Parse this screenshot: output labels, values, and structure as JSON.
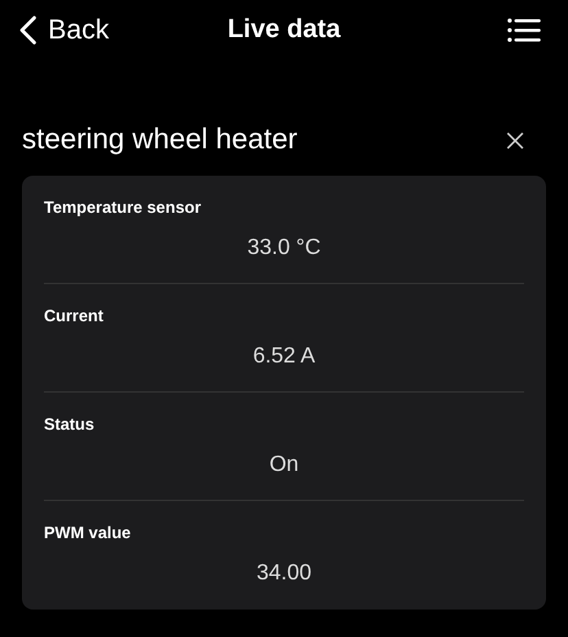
{
  "nav": {
    "back": "Back",
    "title": "Live data"
  },
  "section": {
    "title": "steering wheel heater"
  },
  "readings": [
    {
      "label": "Temperature sensor",
      "value": "33.0 °C"
    },
    {
      "label": "Current",
      "value": "6.52 A"
    },
    {
      "label": "Status",
      "value": "On"
    },
    {
      "label": "PWM value",
      "value": "34.00"
    }
  ]
}
